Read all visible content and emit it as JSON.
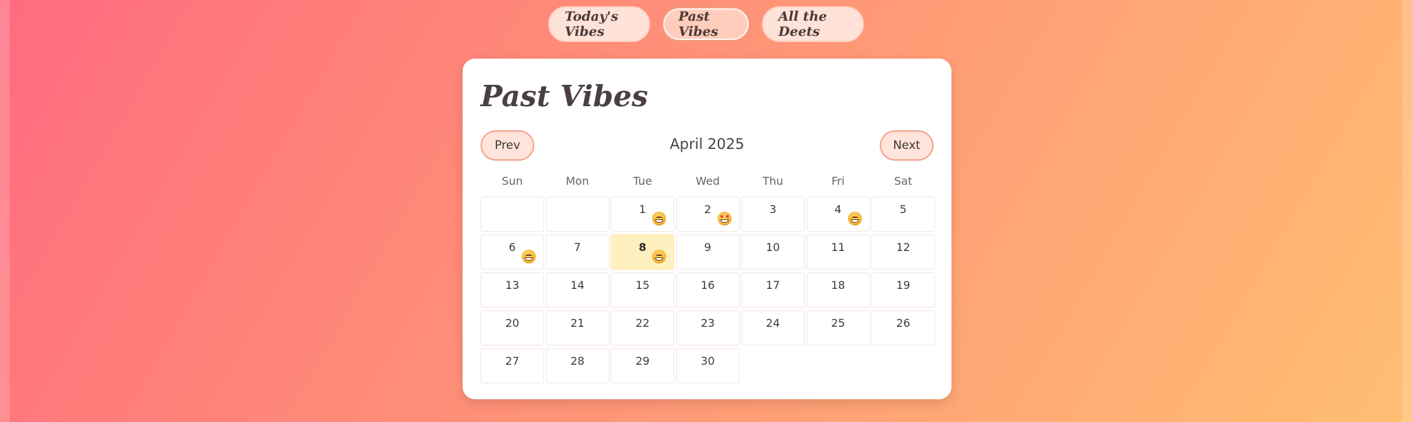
{
  "nav": {
    "tabs": [
      {
        "label": "Today's Vibes",
        "active": false
      },
      {
        "label": "Past Vibes",
        "active": true
      },
      {
        "label": "All the Deets",
        "active": false
      }
    ]
  },
  "card": {
    "title": "Past Vibes",
    "prev_label": "Prev",
    "next_label": "Next",
    "month_label": "April 2025"
  },
  "calendar": {
    "weekdays": [
      "Sun",
      "Mon",
      "Tue",
      "Wed",
      "Thu",
      "Fri",
      "Sat"
    ],
    "today": 8,
    "days": [
      "1",
      "2",
      "3",
      "4",
      "5",
      "6",
      "7",
      "8",
      "9",
      "10",
      "11",
      "12",
      "13",
      "14",
      "15",
      "16",
      "17",
      "18",
      "19",
      "20",
      "21",
      "22",
      "23",
      "24",
      "25",
      "26",
      "27",
      "28",
      "29",
      "30"
    ],
    "moods": {
      "1": "grin-icon",
      "2": "star-struck-icon",
      "4": "grin-icon",
      "6": "grin-icon",
      "8": "grin-icon"
    }
  },
  "colors": {
    "accent": "#f4977d",
    "today_highlight": "#fff1bf",
    "background_start": "#ff6b7f",
    "background_end": "#ffbe72"
  }
}
